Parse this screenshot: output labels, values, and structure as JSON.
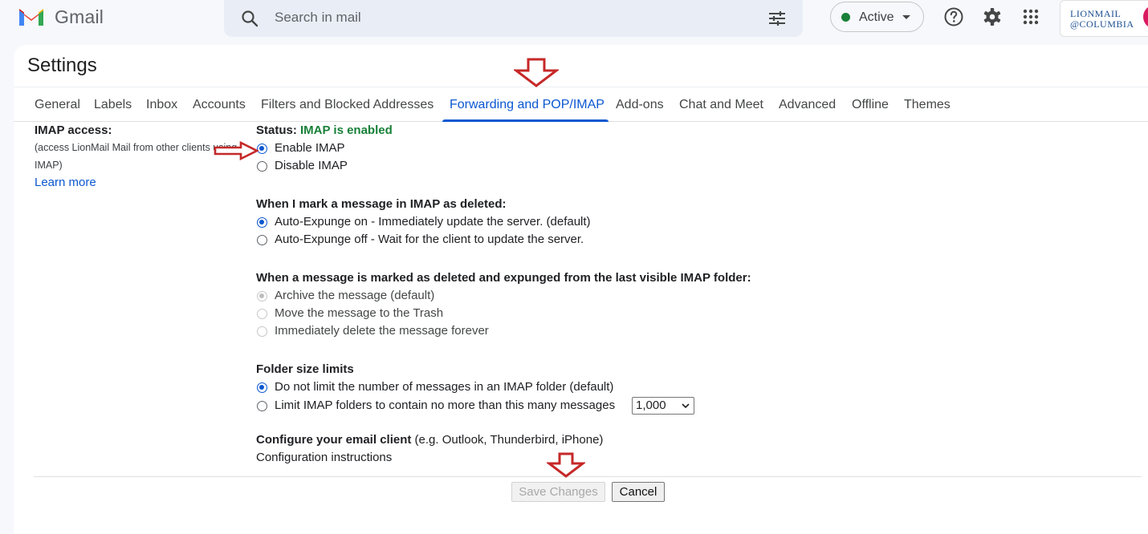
{
  "app": {
    "name": "Gmail"
  },
  "search": {
    "placeholder": "Search in mail"
  },
  "status": {
    "label": "Active"
  },
  "org": {
    "line1": "LIONMAIL",
    "line2": "@COLUMBIA"
  },
  "page": {
    "title": "Settings"
  },
  "tabs": [
    {
      "label": "General"
    },
    {
      "label": "Labels"
    },
    {
      "label": "Inbox"
    },
    {
      "label": "Accounts"
    },
    {
      "label": "Filters and Blocked Addresses"
    },
    {
      "label": "Forwarding and POP/IMAP",
      "active": true
    },
    {
      "label": "Add-ons"
    },
    {
      "label": "Chat and Meet"
    },
    {
      "label": "Advanced"
    },
    {
      "label": "Offline"
    },
    {
      "label": "Themes"
    }
  ],
  "imap": {
    "heading": "IMAP access:",
    "desc_line1": "(access LionMail Mail from other clients using",
    "desc_line2": "IMAP)",
    "learn_more": "Learn more",
    "status_prefix": "Status:",
    "status_value": "IMAP is enabled",
    "enable_label": "Enable IMAP",
    "disable_label": "Disable IMAP",
    "deleted_heading": "When I mark a message in IMAP as deleted:",
    "expunge_on": "Auto-Expunge on - Immediately update the server. (default)",
    "expunge_off": "Auto-Expunge off - Wait for the client to update the server.",
    "expunged_heading": "When a message is marked as deleted and expunged from the last visible IMAP folder:",
    "archive": "Archive the message (default)",
    "trash": "Move the message to the Trash",
    "delete_forever": "Immediately delete the message forever",
    "folder_heading": "Folder size limits",
    "no_limit": "Do not limit the number of messages in an IMAP folder (default)",
    "limit": "Limit IMAP folders to contain no more than this many messages",
    "limit_value": "1,000",
    "client_heading": "Configure your email client",
    "client_examples": "(e.g. Outlook, Thunderbird, iPhone)",
    "config_link": "Configuration instructions"
  },
  "buttons": {
    "save": "Save Changes",
    "cancel": "Cancel"
  },
  "colors": {
    "accent": "#0b57d0",
    "status_green": "#188038",
    "annotation": "#c62828"
  }
}
